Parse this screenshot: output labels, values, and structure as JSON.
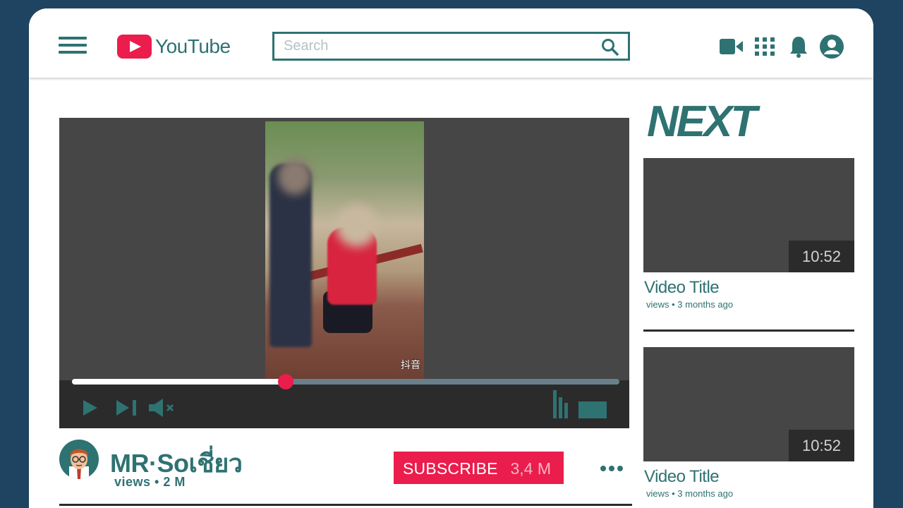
{
  "header": {
    "logo_text": "YouTube",
    "search_placeholder": "Search",
    "icons": [
      "menu-icon",
      "video-camera-icon",
      "apps-grid-icon",
      "bell-icon",
      "account-icon",
      "search-icon"
    ]
  },
  "player": {
    "progress": 0.39,
    "watermark": "抖音",
    "controls": [
      "play-icon",
      "skip-next-icon",
      "mute-icon",
      "equalizer-icon",
      "fullscreen-icon"
    ]
  },
  "channel": {
    "name": "MR·Soเชี่ยว",
    "views": "views • 2 M",
    "subscribe_label": "SUBSCRIBE",
    "subscriber_count": "3,4 M"
  },
  "sidebar": {
    "next_label": "NEXT",
    "videos": [
      {
        "duration": "10:52",
        "title": "Video Title",
        "meta": "views • 3 months ago"
      },
      {
        "duration": "10:52",
        "title": "Video Title",
        "meta": "views • 3 months ago"
      }
    ]
  },
  "colors": {
    "background": "#1e4461",
    "accent": "#2f7272",
    "brand_red": "#ea1d4c",
    "panel": "#464646",
    "dark": "#2b2b2b"
  }
}
